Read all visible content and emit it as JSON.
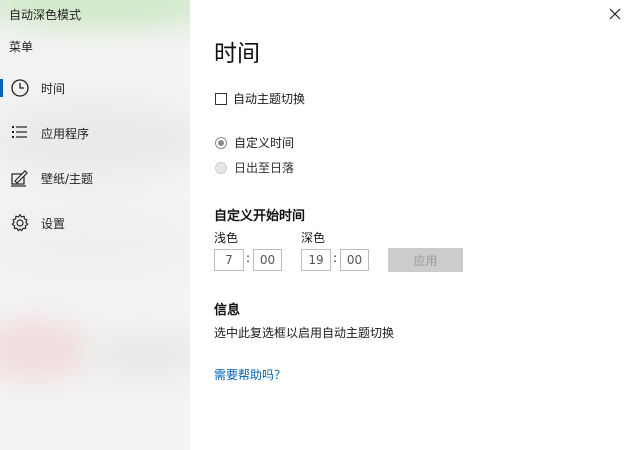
{
  "app": {
    "title": "自动深色模式"
  },
  "sidebar": {
    "menu_label": "菜单",
    "items": [
      {
        "label": "时间",
        "icon": "clock-icon",
        "active": true
      },
      {
        "label": "应用程序",
        "icon": "list-icon",
        "active": false
      },
      {
        "label": "壁纸/主题",
        "icon": "paint-icon",
        "active": false
      },
      {
        "label": "设置",
        "icon": "gear-icon",
        "active": false
      }
    ]
  },
  "main": {
    "title": "时间",
    "auto_switch_checkbox": {
      "label": "自动主题切换",
      "checked": false
    },
    "radios": [
      {
        "label": "自定义时间",
        "checked": true
      },
      {
        "label": "日出至日落",
        "checked": false
      }
    ],
    "custom_start": {
      "heading": "自定义开始时间",
      "light_label": "浅色",
      "dark_label": "深色",
      "light_hour": "7",
      "light_minute": "00",
      "dark_hour": "19",
      "dark_minute": "00",
      "separator": ":",
      "apply_label": "应用"
    },
    "info": {
      "heading": "信息",
      "text": "选中此复选框以启用自动主题切换"
    },
    "help_link": "需要帮助吗？"
  },
  "colors": {
    "accent": "#0063b1",
    "button_disabled": "#cccccc"
  }
}
